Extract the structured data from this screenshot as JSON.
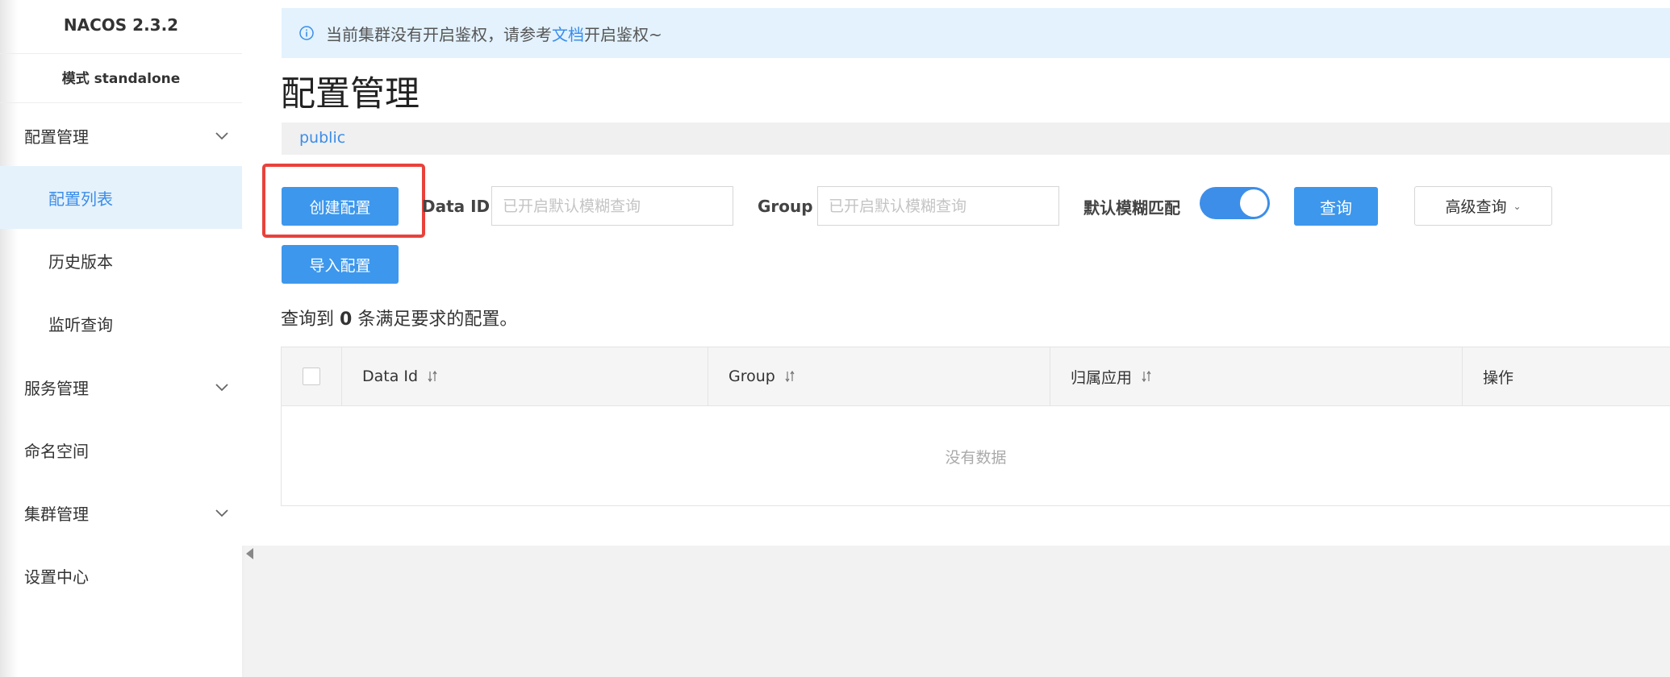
{
  "app": {
    "title": "NACOS 2.3.2",
    "mode_label": "模式 standalone"
  },
  "sidebar": {
    "items": [
      {
        "label": "配置管理",
        "expandable": true
      },
      {
        "label": "配置列表",
        "active": true
      },
      {
        "label": "历史版本"
      },
      {
        "label": "监听查询"
      },
      {
        "label": "服务管理",
        "expandable": true
      },
      {
        "label": "命名空间"
      },
      {
        "label": "集群管理",
        "expandable": true
      },
      {
        "label": "设置中心"
      }
    ]
  },
  "notice": {
    "text_before": "当前集群没有开启鉴权，请参考",
    "link": "文档",
    "text_after": "开启鉴权~"
  },
  "page": {
    "title": "配置管理",
    "namespace": "public"
  },
  "toolbar": {
    "create_label": "创建配置",
    "import_label": "导入配置",
    "data_id_label": "Data ID",
    "data_id_placeholder": "已开启默认模糊查询",
    "group_label": "Group",
    "group_placeholder": "已开启默认模糊查询",
    "fuzzy_label": "默认模糊匹配",
    "fuzzy_enabled": true,
    "search_label": "查询",
    "advanced_label": "高级查询"
  },
  "result": {
    "prefix": "查询到",
    "count": "0",
    "suffix": "条满足要求的配置。"
  },
  "table": {
    "columns": [
      "Data Id",
      "Group",
      "归属应用",
      "操作"
    ],
    "empty_text": "没有数据"
  },
  "colors": {
    "primary": "#3d97ec",
    "highlight": "#e8423b",
    "notice_bg": "#e3f2fd"
  }
}
